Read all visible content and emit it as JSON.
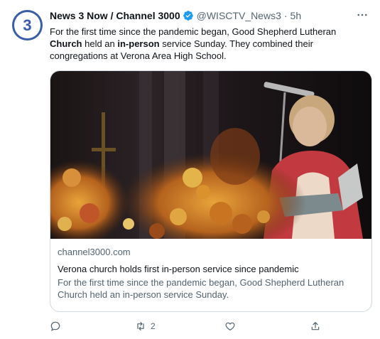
{
  "tweet": {
    "author_name": "News 3 Now / Channel 3000",
    "handle": "@WISCTV_News3",
    "separator": "·",
    "time": "5h",
    "avatar_text": "3",
    "text_parts": [
      {
        "text": "For the first time since the pandemic began, Good Shepherd Lutheran ",
        "bold": false
      },
      {
        "text": "Church",
        "bold": true
      },
      {
        "text": " held an ",
        "bold": false
      },
      {
        "text": "in-person",
        "bold": true
      },
      {
        "text": " service Sunday. They combined their congregations at Verona Area High School.",
        "bold": false
      }
    ]
  },
  "card": {
    "image_description": "photo",
    "domain": "channel3000.com",
    "title": "Verona church holds first in-person service since pandemic",
    "description": "For the first time since the pandemic began, Good Shepherd Lutheran Church held an in-person service Sunday."
  },
  "actions": {
    "reply_count": "",
    "retweet_count": "2",
    "like_count": "",
    "share_count": ""
  },
  "icons": {
    "verified": "verified-badge-icon",
    "more": "more-icon",
    "reply": "reply-icon",
    "retweet": "retweet-icon",
    "like": "like-icon",
    "share": "share-icon"
  },
  "colors": {
    "verified": "#1d9bf0",
    "avatar": "#3a5da8",
    "secondary_text": "#536471",
    "border": "#cfd9de"
  }
}
